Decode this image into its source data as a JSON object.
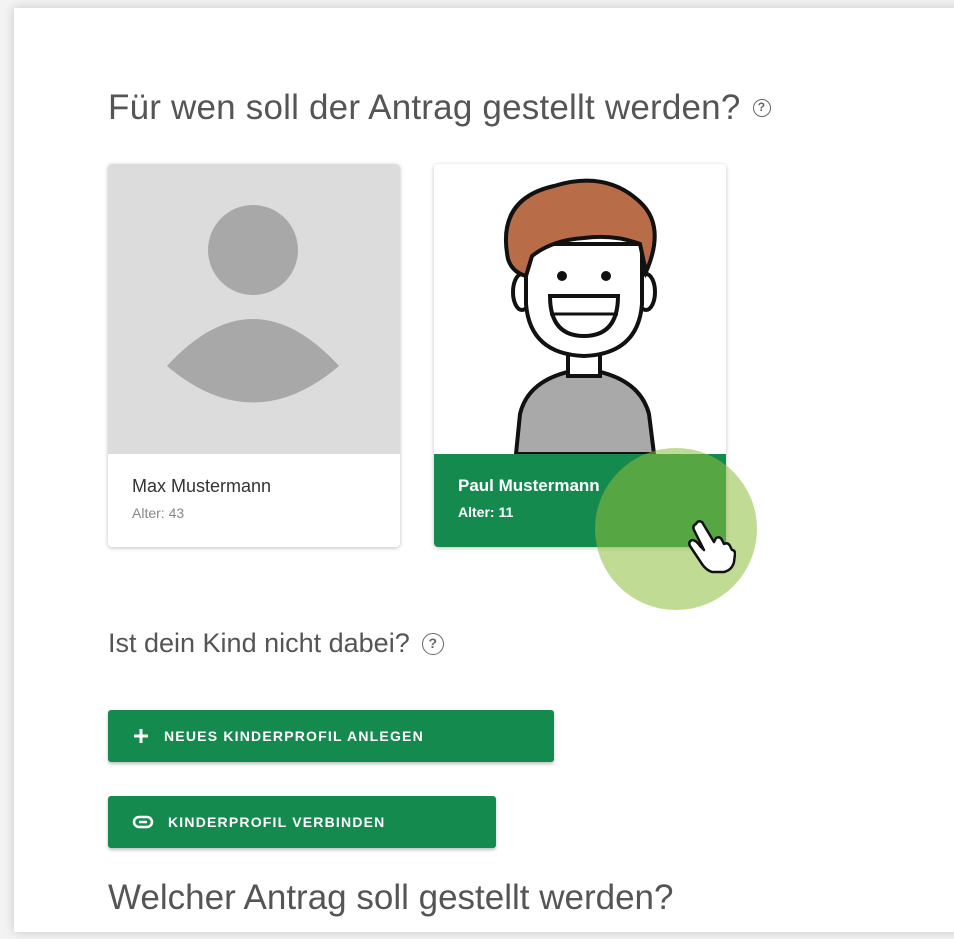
{
  "section1": {
    "heading": "Für wen soll der Antrag gestellt werden?",
    "help_icon": "help-circle-icon"
  },
  "profiles": [
    {
      "name": "Max Mustermann",
      "age": "Alter: 43",
      "avatar": "default-person-placeholder",
      "selected": false
    },
    {
      "name": "Paul Mustermann",
      "age": "Alter: 11",
      "avatar": "cartoon-boy-smiling",
      "selected": true
    }
  ],
  "section2": {
    "heading": "Ist dein Kind nicht dabei?",
    "help_icon": "help-circle-icon"
  },
  "buttons": {
    "new_profile": {
      "label": "NEUES KINDERPROFIL ANLEGEN",
      "icon": "plus-icon"
    },
    "connect_profile": {
      "label": "KINDERPROFIL VERBINDEN",
      "icon": "link-icon"
    }
  },
  "section3": {
    "heading": "Welcher Antrag soll gestellt werden?"
  },
  "colors": {
    "accent": "#158a4f",
    "click_highlight": "#8cbe3c"
  }
}
